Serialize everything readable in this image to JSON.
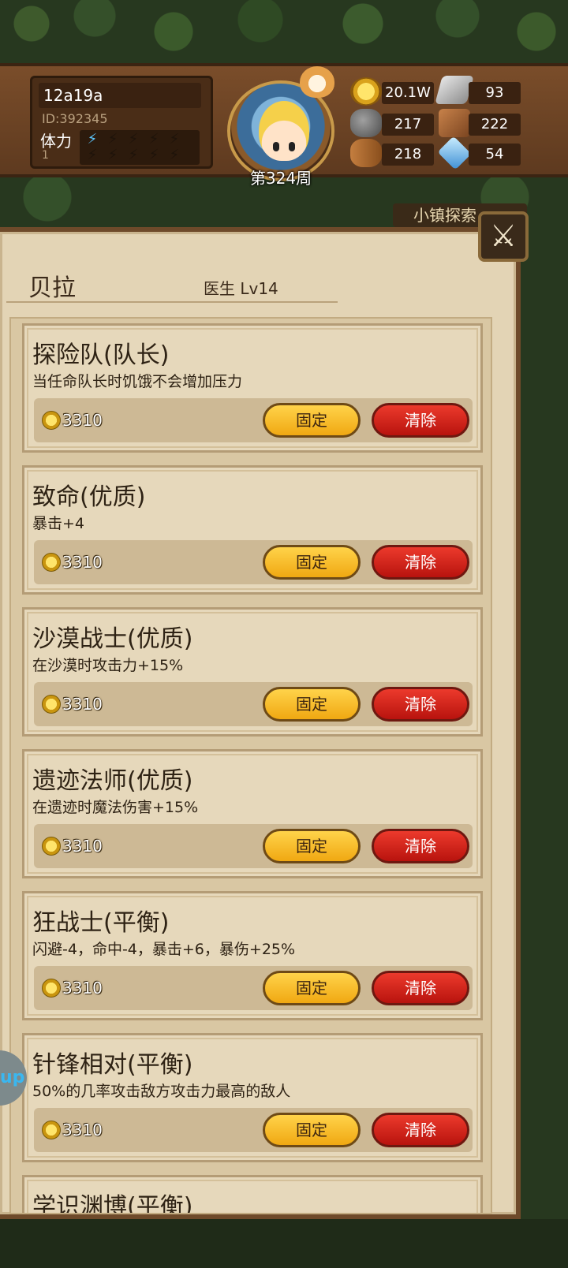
{
  "player": {
    "name": "12a19a",
    "id": "ID:392345",
    "stamina_label": "体力",
    "stamina_count": "1",
    "stamina_filled": 1,
    "stamina_max": 10,
    "week": "第324周"
  },
  "resources": {
    "gold": "20.1W",
    "iron": "93",
    "stone": "217",
    "leather": "222",
    "wood": "218",
    "crystal": "54"
  },
  "town_tag": "小镇探索",
  "panel": {
    "name": "贝拉",
    "class_level": "医生 Lv14"
  },
  "buttons": {
    "fix": "固定",
    "clear": "清除",
    "close_icon": "crossed-swords-icon"
  },
  "traits": [
    {
      "title": "探险队(队长)",
      "desc": "当任命队长时饥饿不会增加压力",
      "cost": "3310"
    },
    {
      "title": "致命(优质)",
      "desc": "暴击+4",
      "cost": "3310"
    },
    {
      "title": "沙漠战士(优质)",
      "desc": "在沙漠时攻击力+15%",
      "cost": "3310"
    },
    {
      "title": "遗迹法师(优质)",
      "desc": "在遗迹时魔法伤害+15%",
      "cost": "3310"
    },
    {
      "title": "狂战士(平衡)",
      "desc": "闪避-4，命中-4，暴击+6，暴伤+25%",
      "cost": "3310"
    },
    {
      "title": "针锋相对(平衡)",
      "desc": "50%的几率攻击敌方攻击力最高的敌人",
      "cost": "3310"
    },
    {
      "title": "学识渊博(平衡)",
      "desc": "",
      "cost": ""
    }
  ],
  "side_tab": "up"
}
